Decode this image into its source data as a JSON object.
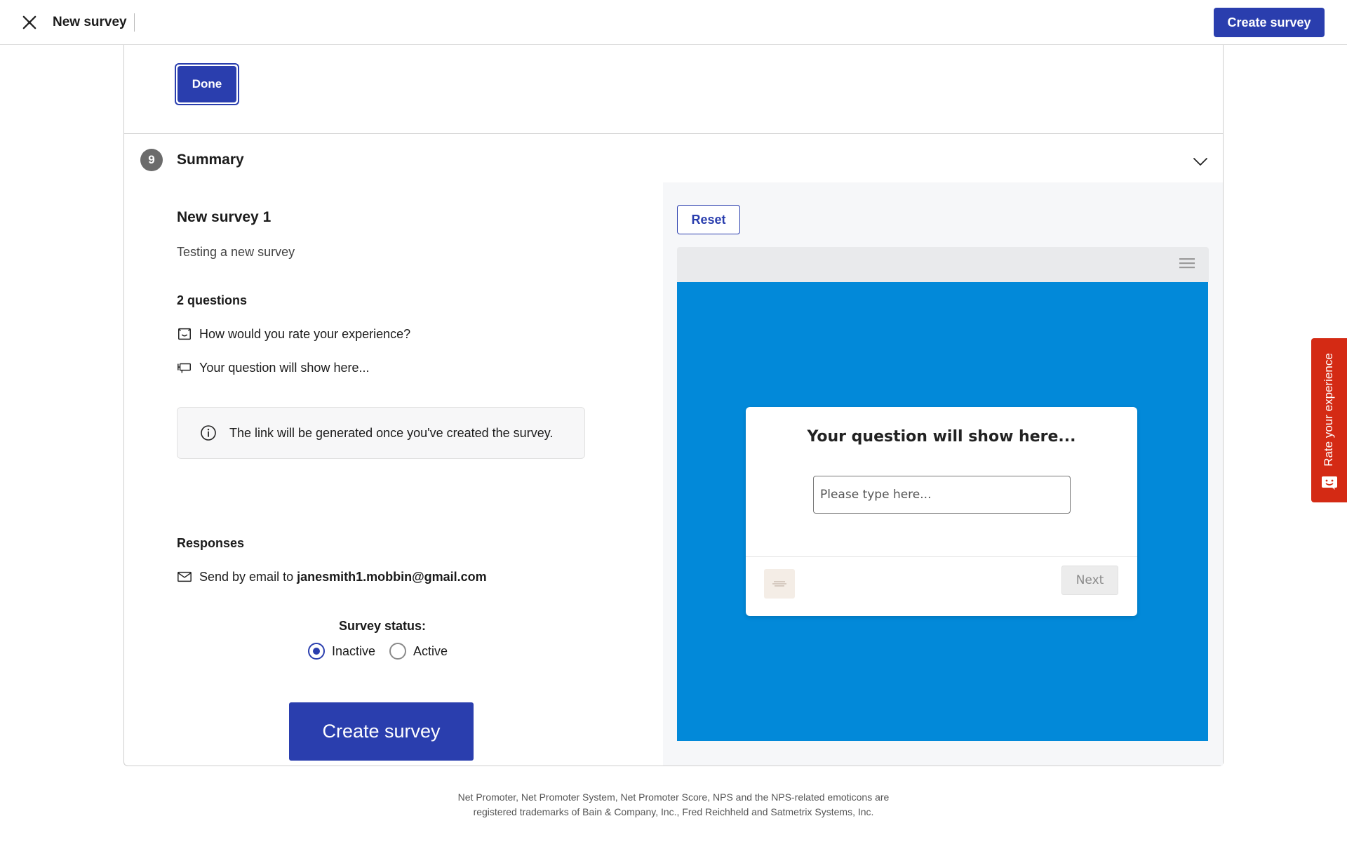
{
  "header": {
    "title": "New survey",
    "create_label": "Create survey"
  },
  "edit_section": {
    "done_label": "Done"
  },
  "summary": {
    "step_number": "9",
    "title": "Summary",
    "survey_name": "New survey 1",
    "survey_description": "Testing a new survey",
    "questions_count": "2 questions",
    "questions": [
      {
        "text": "How would you rate your experience?",
        "icon": "rating-icon"
      },
      {
        "text": "Your question will show here...",
        "icon": "text-question-icon"
      }
    ],
    "info_text": "The link will be generated once you've created the survey.",
    "responses_title": "Responses",
    "email_prefix": "Send by email to",
    "email_address": "janesmith1.mobbin@gmail.com",
    "status_label": "Survey status:",
    "status_options": [
      {
        "label": "Inactive",
        "selected": true
      },
      {
        "label": "Active",
        "selected": false
      }
    ],
    "create_label": "Create survey"
  },
  "preview": {
    "reset_label": "Reset",
    "question_title": "Your question will show here...",
    "input_placeholder": "Please type here...",
    "next_label": "Next",
    "stage_color": "#0289d9"
  },
  "footer": {
    "line1": "Net Promoter, Net Promoter System, Net Promoter Score, NPS and the NPS-related emoticons are",
    "line2": "registered trademarks of Bain & Company, Inc., Fred Reichheld and Satmetrix Systems, Inc."
  },
  "side_tab": {
    "label": "Rate your experience",
    "color": "#d42a14"
  },
  "theme": {
    "accent": "#2a3eae"
  }
}
